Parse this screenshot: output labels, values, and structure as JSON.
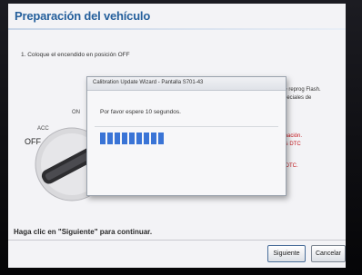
{
  "window": {
    "title": "Preparación del vehículo",
    "step1": "1. Coloque el encendido en posición OFF",
    "right_texts": [
      "de reprog Flash.",
      "speciales de"
    ],
    "right_red_texts": [
      "rmación.",
      "los DTC",
      "s DTC."
    ],
    "footer_instruction": "Haga clic en \"Siguiente\" para continuar.",
    "buttons": {
      "next": "Siguiente",
      "cancel": "Cancelar"
    }
  },
  "ignition": {
    "labels": {
      "acc": "ACC",
      "on": "ON",
      "off": "OFF"
    }
  },
  "dialog": {
    "title": "Calibration Update Wizard - Pantalla S701-43",
    "message": "Por favor espere 10 segundos.",
    "progress": 0.37
  },
  "colors": {
    "title_blue": "#26609c",
    "progress_blue": "#3a74d6",
    "warning_red": "#c3151b"
  }
}
